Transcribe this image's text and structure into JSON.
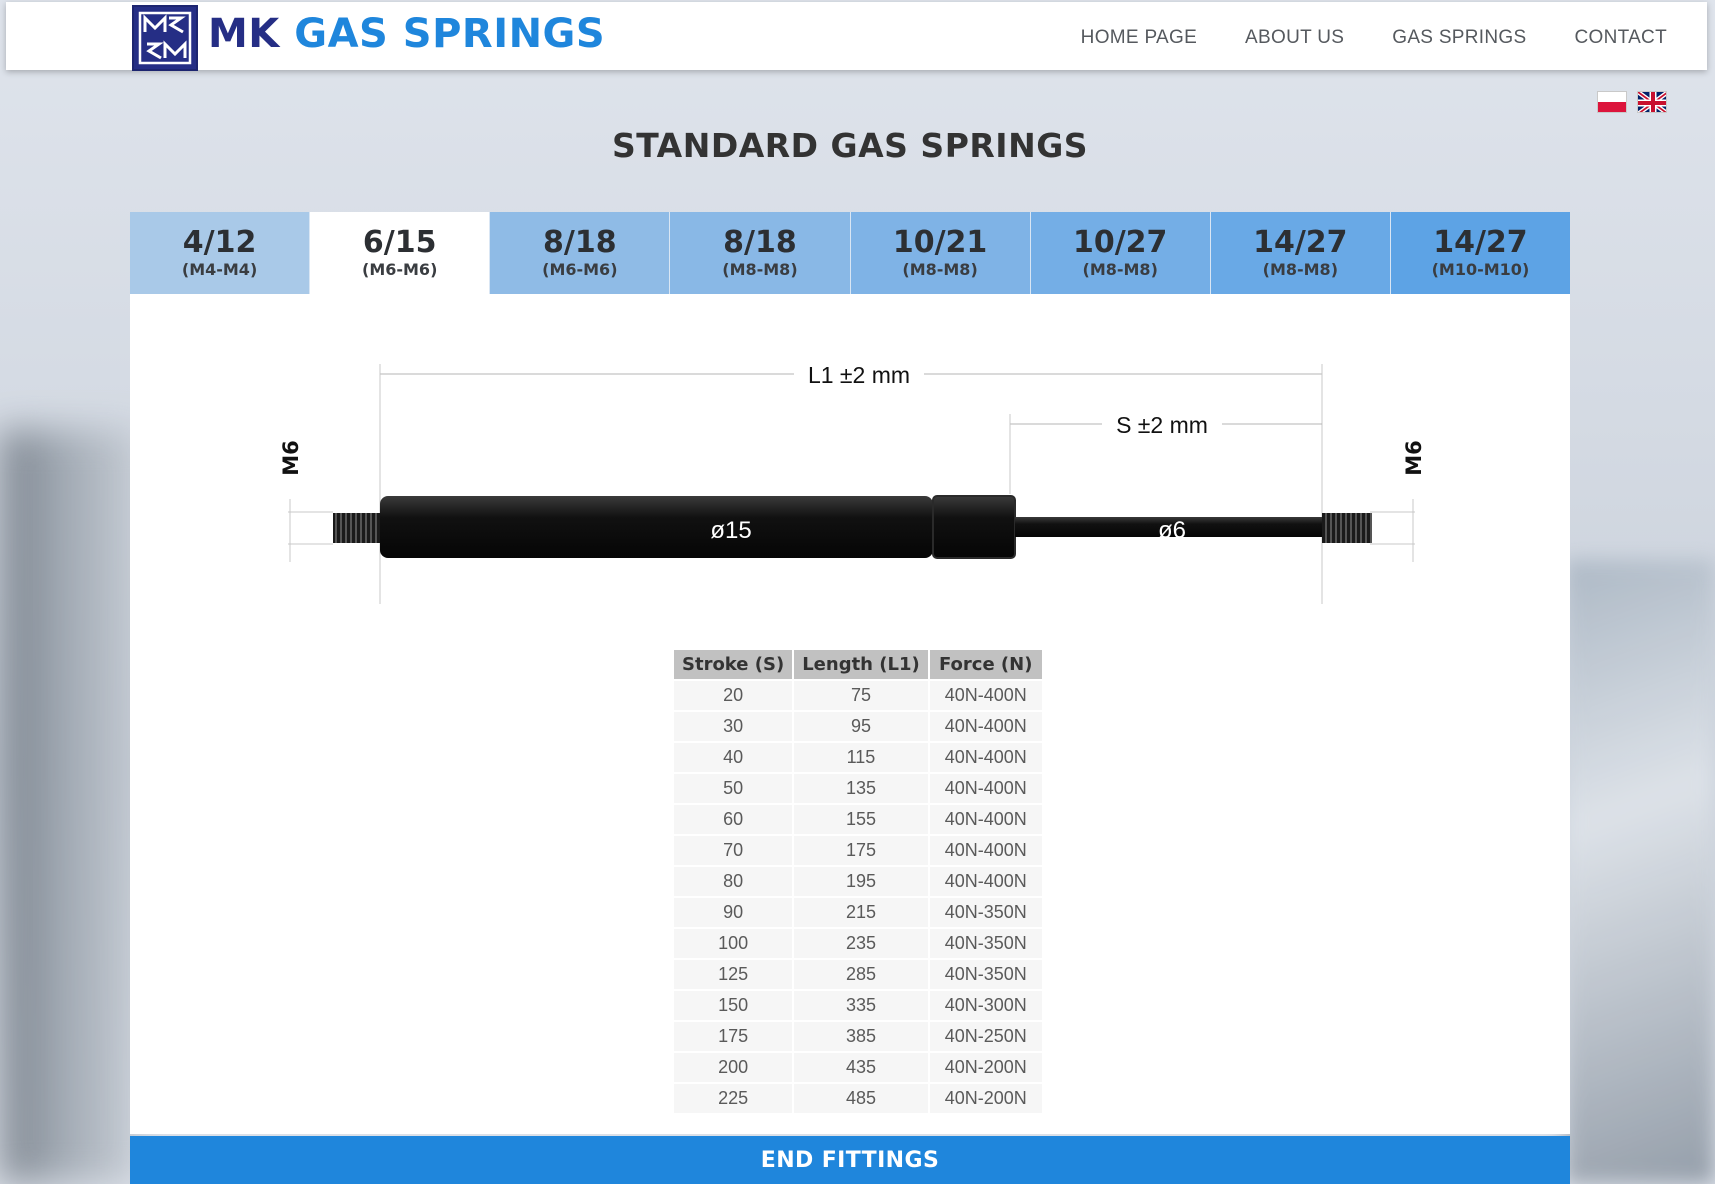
{
  "brand": {
    "mk": "MK",
    "rest": "GAS SPRINGS"
  },
  "nav": [
    {
      "label": "HOME PAGE"
    },
    {
      "label": "ABOUT US"
    },
    {
      "label": "GAS SPRINGS"
    },
    {
      "label": "CONTACT"
    }
  ],
  "page_title": "STANDARD GAS SPRINGS",
  "tabs": [
    {
      "size": "4/12",
      "thread": "(M4-M4)",
      "color": "#a9c9e8"
    },
    {
      "size": "6/15",
      "thread": "(M6-M6)",
      "color": "#ffffff",
      "active": true
    },
    {
      "size": "8/18",
      "thread": "(M6-M6)",
      "color": "#8fbbe6"
    },
    {
      "size": "8/18",
      "thread": "(M8-M8)",
      "color": "#89b8e6"
    },
    {
      "size": "10/21",
      "thread": "(M8-M8)",
      "color": "#7fb3e6"
    },
    {
      "size": "10/27",
      "thread": "(M8-M8)",
      "color": "#74aee6"
    },
    {
      "size": "14/27",
      "thread": "(M8-M8)",
      "color": "#69a9e6"
    },
    {
      "size": "14/27",
      "thread": "(M10-M10)",
      "color": "#5da3e5"
    }
  ],
  "drawing": {
    "l1_label": "L1 ±2 mm",
    "s_label": "S ±2 mm",
    "left_thread": "M6",
    "right_thread": "M6",
    "body_diameter": "ø15",
    "rod_diameter": "ø6"
  },
  "table": {
    "headers": [
      "Stroke (S)",
      "Length (L1)",
      "Force (N)"
    ],
    "rows": [
      [
        "20",
        "75",
        "40N-400N"
      ],
      [
        "30",
        "95",
        "40N-400N"
      ],
      [
        "40",
        "115",
        "40N-400N"
      ],
      [
        "50",
        "135",
        "40N-400N"
      ],
      [
        "60",
        "155",
        "40N-400N"
      ],
      [
        "70",
        "175",
        "40N-400N"
      ],
      [
        "80",
        "195",
        "40N-400N"
      ],
      [
        "90",
        "215",
        "40N-350N"
      ],
      [
        "100",
        "235",
        "40N-350N"
      ],
      [
        "125",
        "285",
        "40N-350N"
      ],
      [
        "150",
        "335",
        "40N-300N"
      ],
      [
        "175",
        "385",
        "40N-250N"
      ],
      [
        "200",
        "435",
        "40N-200N"
      ],
      [
        "225",
        "485",
        "40N-200N"
      ]
    ]
  },
  "end_fittings": "END FITTINGS",
  "colors": {
    "brand_dark": "#252e85",
    "brand_blue": "#1f86dc"
  }
}
